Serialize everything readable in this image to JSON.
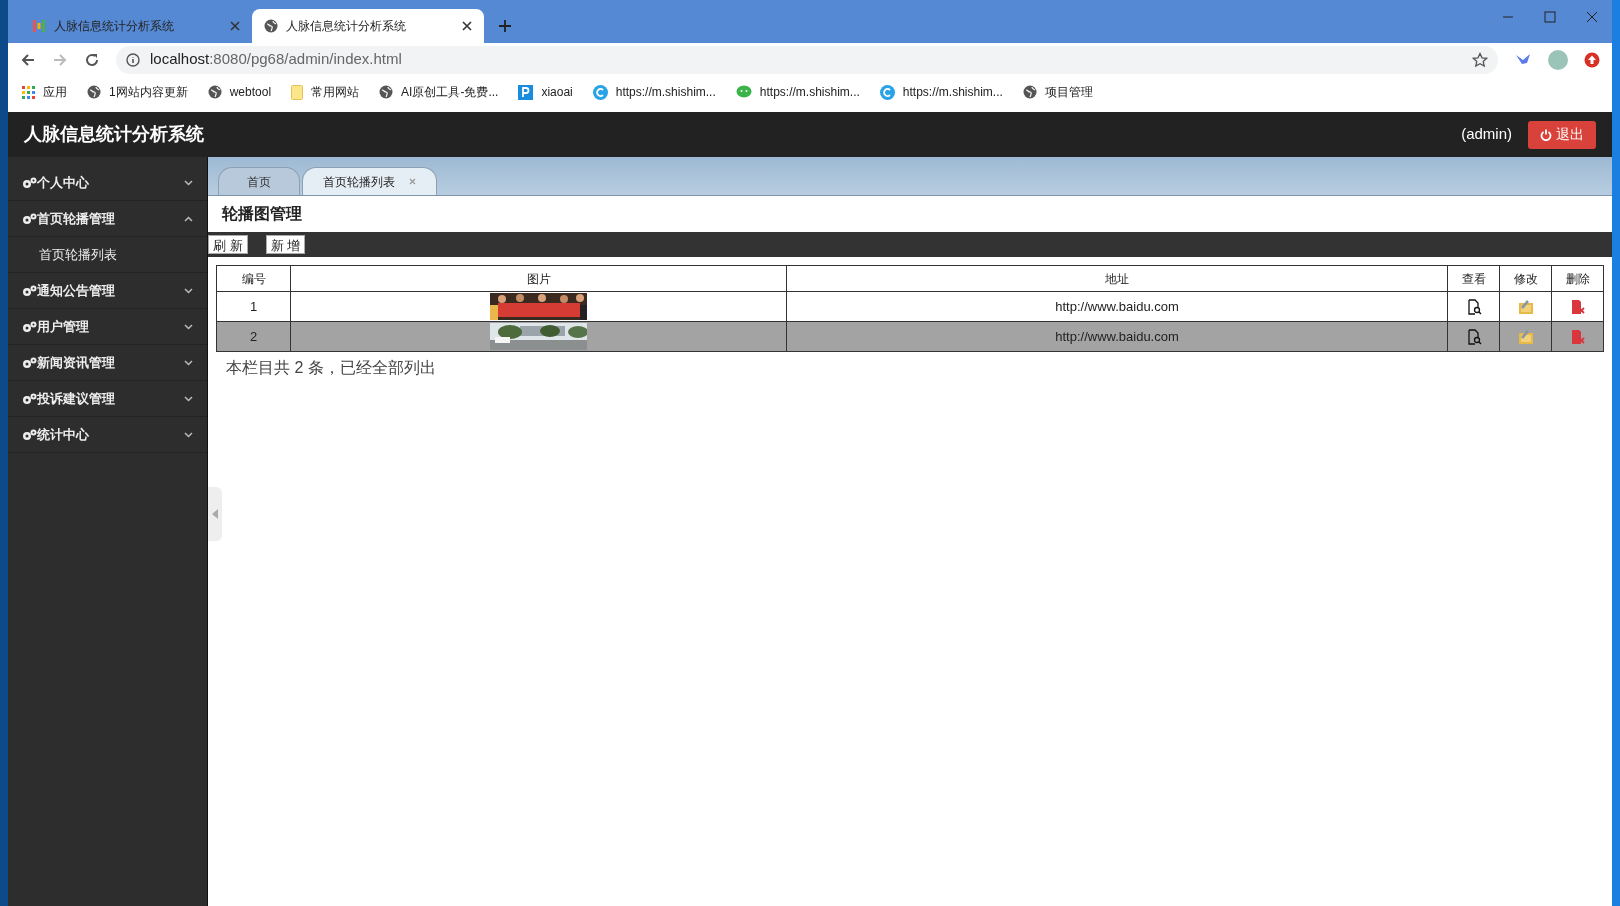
{
  "browser": {
    "tabs": [
      {
        "title": "人脉信息统计分析系统",
        "selected": false
      },
      {
        "title": "人脉信息统计分析系统",
        "selected": true
      }
    ],
    "address": {
      "host": "localhost",
      "rest": ":8080/pg68/admin/index.html"
    },
    "bookmarks": [
      {
        "kind": "apps",
        "label": "应用"
      },
      {
        "kind": "globe",
        "label": "1网站内容更新"
      },
      {
        "kind": "globe",
        "label": "webtool"
      },
      {
        "kind": "folder",
        "label": "常用网站"
      },
      {
        "kind": "globe",
        "label": "AI原创工具-免费..."
      },
      {
        "kind": "square",
        "label": "xiaoai"
      },
      {
        "kind": "ring",
        "label": "https://m.shishim..."
      },
      {
        "kind": "chat",
        "label": "https://m.shishim..."
      },
      {
        "kind": "ring",
        "label": "https://m.shishim..."
      },
      {
        "kind": "globe",
        "label": "项目管理"
      }
    ]
  },
  "app": {
    "title": "人脉信息统计分析系统",
    "user": "(admin)",
    "logout": "退出"
  },
  "sidebar": {
    "items": [
      {
        "label": "个人中心",
        "expanded": false
      },
      {
        "label": "首页轮播管理",
        "expanded": true,
        "children": [
          {
            "label": "首页轮播列表"
          }
        ]
      },
      {
        "label": "通知公告管理",
        "expanded": false
      },
      {
        "label": "用户管理",
        "expanded": false
      },
      {
        "label": "新闻资讯管理",
        "expanded": false
      },
      {
        "label": "投诉建议管理",
        "expanded": false
      },
      {
        "label": "统计中心",
        "expanded": false
      }
    ]
  },
  "page_tabs": [
    {
      "label": "首页",
      "selected": false,
      "closable": false
    },
    {
      "label": "首页轮播列表",
      "selected": true,
      "closable": true
    }
  ],
  "heading": "轮播图管理",
  "toolbar": [
    "刷 新",
    "新 增"
  ],
  "table": {
    "columns": [
      "编号",
      "图片",
      "地址",
      "查看",
      "修改",
      "删除"
    ],
    "rows": [
      {
        "id": "1",
        "url": "http://www.baidu.com",
        "highlighted": false
      },
      {
        "id": "2",
        "url": "http://www.baidu.com",
        "highlighted": true
      }
    ]
  },
  "footer": "本栏目共 2 条，已经全部列出"
}
